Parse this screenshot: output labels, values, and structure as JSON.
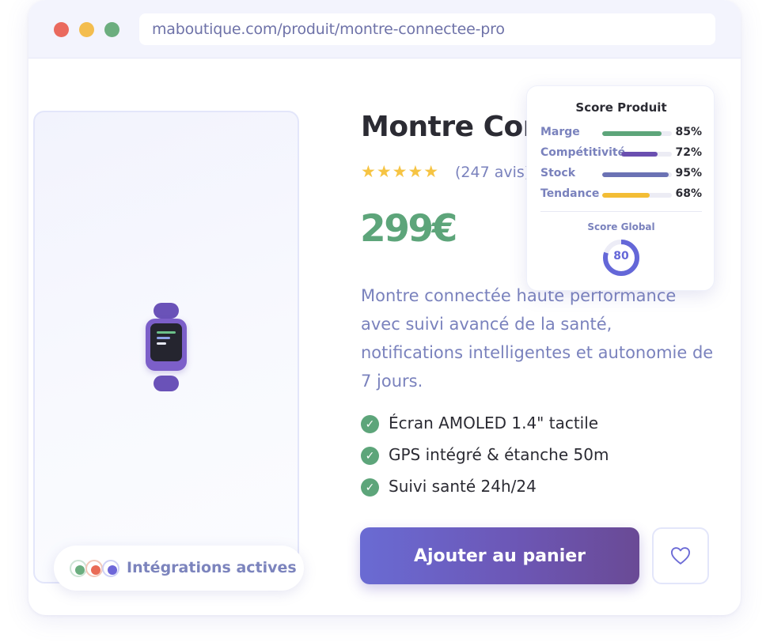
{
  "browser": {
    "url": "maboutique.com/produit/montre-connectee-pro"
  },
  "product": {
    "title": "Montre Con",
    "rating_stars": "★★★★★",
    "reviews": "(247 avis)",
    "price": "299€",
    "description": "Montre connectée haute performance avec suivi avancé de la santé, notifications intelligentes et autonomie de 7 jours.",
    "features": [
      "Écran AMOLED 1.4\" tactile",
      "GPS intégré & étanche 50m",
      "Suivi santé 24h/24"
    ],
    "image_icon": "smartwatch-icon"
  },
  "actions": {
    "add_to_cart": "Ajouter au panier",
    "favorite_icon": "heart-icon"
  },
  "integrations": {
    "label": "Intégrations actives",
    "colors": [
      "#6bae7f",
      "#e96b55",
      "#6e67d9"
    ]
  },
  "score_card": {
    "title": "Score Produit",
    "metrics": [
      {
        "label": "Marge",
        "value": 85,
        "display": "85%",
        "color": "#5da57a"
      },
      {
        "label": "Compétitivité",
        "value": 72,
        "display": "72%",
        "color": "#6a4fb0"
      },
      {
        "label": "Stock",
        "value": 95,
        "display": "95%",
        "color": "#6b72b4"
      },
      {
        "label": "Tendance",
        "value": 68,
        "display": "68%",
        "color": "#f3bd35"
      }
    ],
    "global_label": "Score Global",
    "global_score": 80
  },
  "colors": {
    "accent": "#6467d8",
    "price": "#5da57a",
    "text_muted": "#7a82bd"
  }
}
